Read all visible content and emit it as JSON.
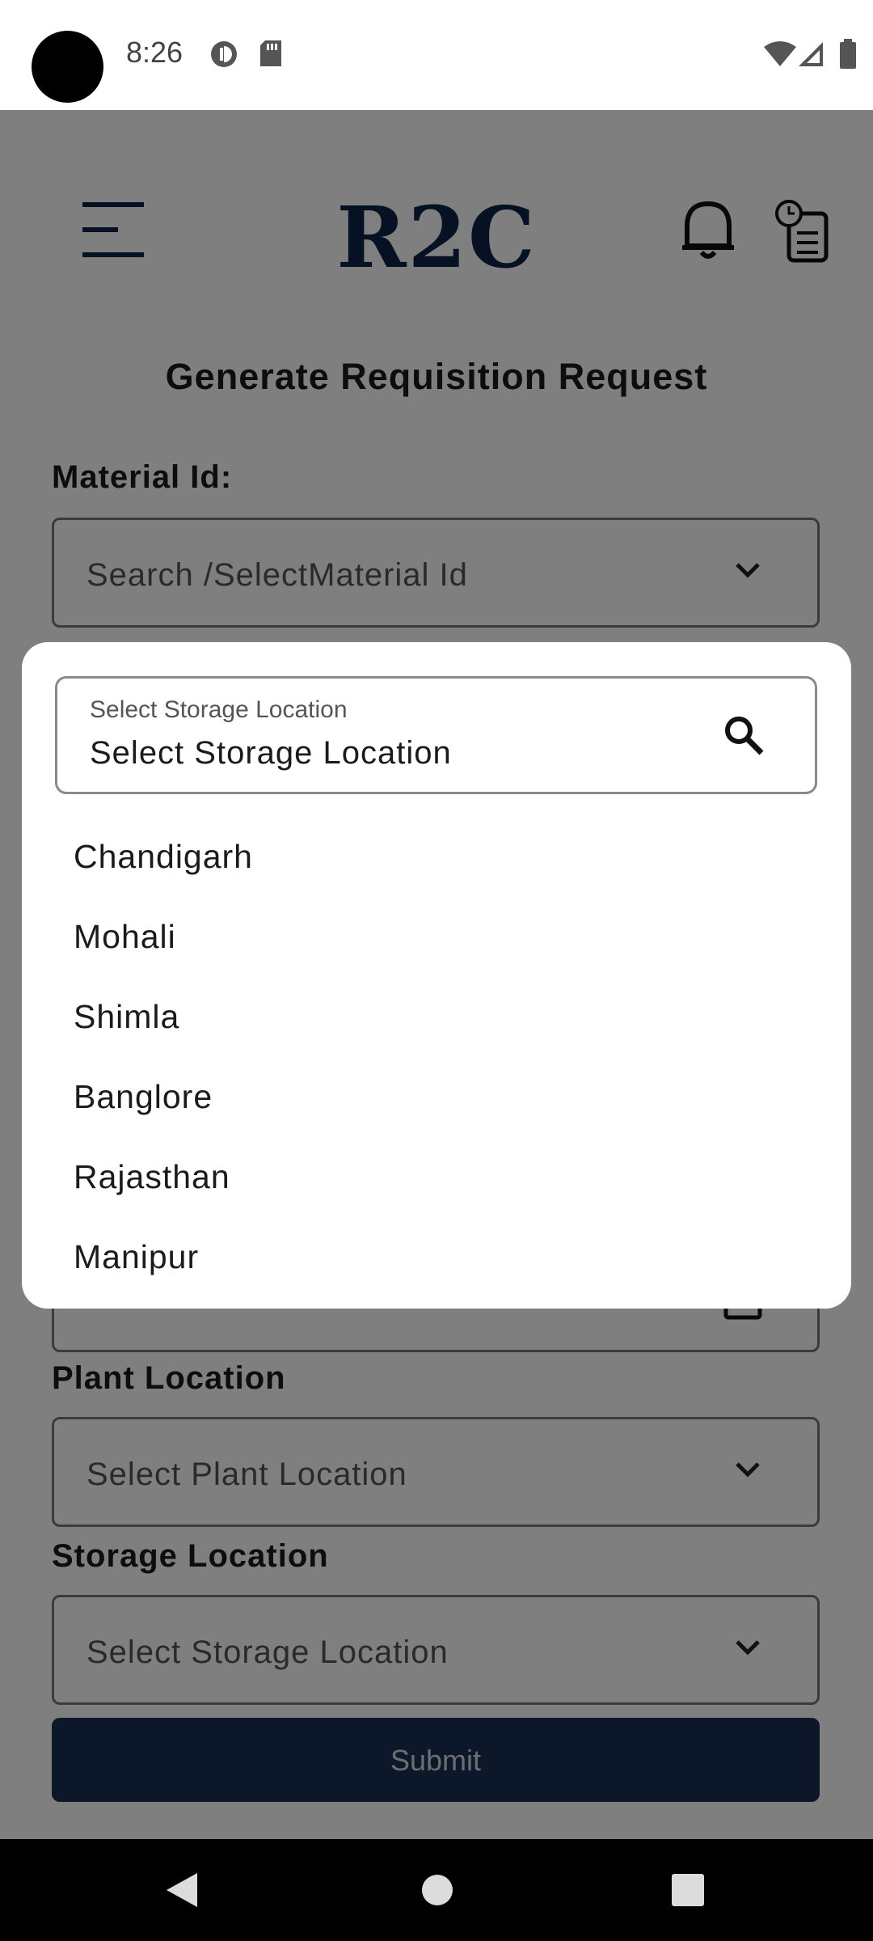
{
  "status_bar": {
    "time": "8:26",
    "left_icons": [
      "data-saver-icon",
      "sd-card-icon"
    ],
    "right_icons": [
      "wifi-icon",
      "signal-icon",
      "battery-icon"
    ]
  },
  "header": {
    "logo": "R2C",
    "icons": [
      "menu-icon",
      "bell-icon",
      "history-icon"
    ]
  },
  "page": {
    "title": "Generate Requisition Request",
    "material": {
      "label": "Material Id:",
      "placeholder": "Search /SelectMaterial Id"
    },
    "plant": {
      "label": "Plant Location",
      "placeholder": "Select Plant Location"
    },
    "storage": {
      "label": "Storage Location",
      "placeholder": "Select Storage Location"
    },
    "submit_label": "Submit"
  },
  "dialog": {
    "search_label": "Select Storage Location",
    "search_value": "Select Storage Location",
    "options": [
      "Chandigarh",
      "Mohali",
      "Shimla",
      "Banglore",
      "Rajasthan",
      "Manipur"
    ]
  },
  "colors": {
    "brand": "#0d2447",
    "submit": "#1a2f55",
    "scrim": "rgba(0,0,0,0.5)"
  }
}
